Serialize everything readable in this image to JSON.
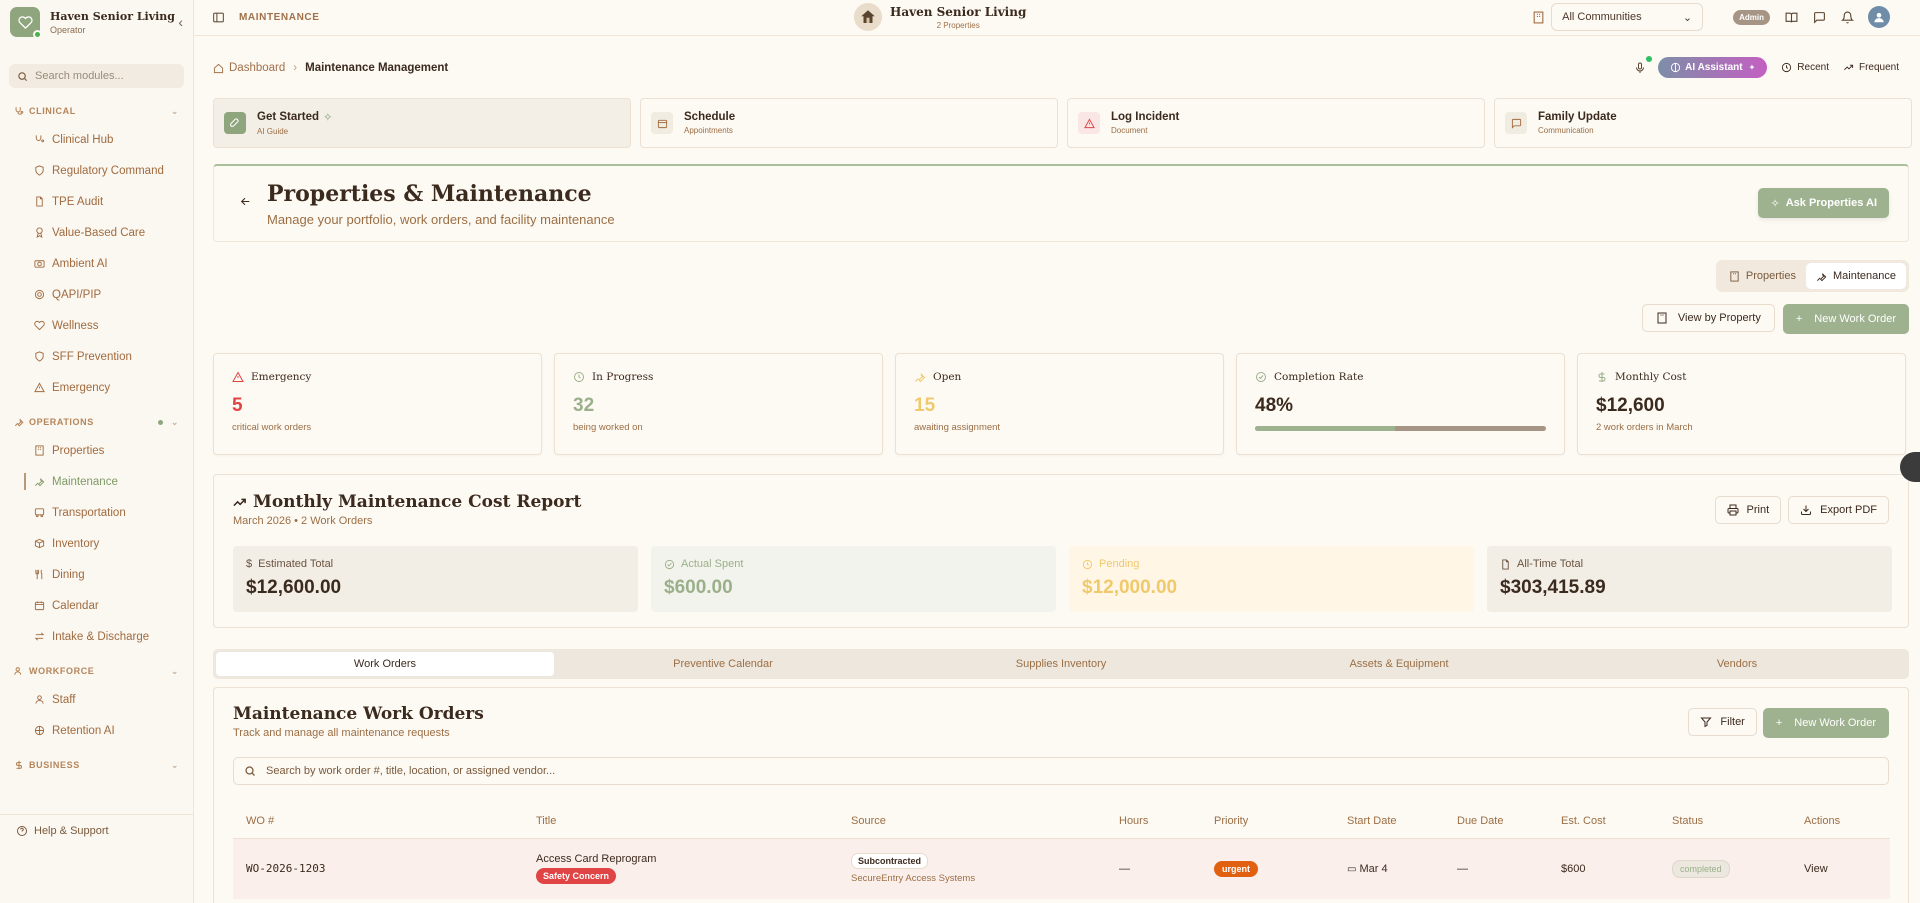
{
  "brand": {
    "name": "Haven Senior Living",
    "role": "Operator"
  },
  "sidebar": {
    "search_placeholder": "Search modules...",
    "sections": {
      "clinical": {
        "label": "CLINICAL",
        "items": [
          "Clinical Hub",
          "Regulatory Command",
          "TPE Audit",
          "Value-Based Care",
          "Ambient AI",
          "QAPI/PIP",
          "Wellness",
          "SFF Prevention",
          "Emergency"
        ]
      },
      "operations": {
        "label": "OPERATIONS",
        "items": [
          "Properties",
          "Maintenance",
          "Transportation",
          "Inventory",
          "Dining",
          "Calendar",
          "Intake & Discharge"
        ]
      },
      "workforce": {
        "label": "WORKFORCE",
        "items": [
          "Staff",
          "Retention AI"
        ]
      },
      "business": {
        "label": "BUSINESS"
      }
    },
    "help": "Help & Support"
  },
  "topbar": {
    "page": "MAINTENANCE",
    "center_title": "Haven Senior Living",
    "center_sub": "2 Properties",
    "community": "All Communities",
    "admin": "Admin"
  },
  "breadcrumb": {
    "home": "Dashboard",
    "current": "Maintenance Management"
  },
  "header_actions": {
    "ai": "AI Assistant",
    "recent": "Recent",
    "frequent": "Frequent"
  },
  "quick_actions": [
    {
      "title": "Get Started",
      "sub": "AI Guide"
    },
    {
      "title": "Schedule",
      "sub": "Appointments"
    },
    {
      "title": "Log Incident",
      "sub": "Document"
    },
    {
      "title": "Family Update",
      "sub": "Communication"
    }
  ],
  "hero": {
    "title": "Properties & Maintenance",
    "subtitle": "Manage your portfolio, work orders, and facility maintenance",
    "ask": "Ask Properties AI"
  },
  "view_toggle": {
    "properties": "Properties",
    "maintenance": "Maintenance"
  },
  "actions": {
    "view_by_property": "View by Property",
    "new_work_order": "New Work Order"
  },
  "stats": [
    {
      "label": "Emergency",
      "value": "5",
      "sub": "critical work orders",
      "color": "#e04444"
    },
    {
      "label": "In Progress",
      "value": "32",
      "sub": "being worked on",
      "color": "#9bb08a"
    },
    {
      "label": "Open",
      "value": "15",
      "sub": "awaiting assignment",
      "color": "#f0c96c"
    },
    {
      "label": "Completion Rate",
      "value": "48%",
      "progress": 48,
      "color": "#3b2a1e"
    },
    {
      "label": "Monthly Cost",
      "value": "$12,600",
      "sub": "2 work orders in March",
      "color": "#3b2a1e"
    }
  ],
  "report": {
    "title": "Monthly Maintenance Cost Report",
    "sub": "March 2026 • 2 Work Orders",
    "print": "Print",
    "export": "Export PDF",
    "cards": [
      {
        "label": "Estimated Total",
        "value": "$12,600.00"
      },
      {
        "label": "Actual Spent",
        "value": "$600.00"
      },
      {
        "label": "Pending",
        "value": "$12,000.00"
      },
      {
        "label": "All-Time Total",
        "value": "$303,415.89"
      }
    ]
  },
  "tabs": [
    "Work Orders",
    "Preventive Calendar",
    "Supplies Inventory",
    "Assets & Equipment",
    "Vendors"
  ],
  "work_orders": {
    "title": "Maintenance Work Orders",
    "sub": "Track and manage all maintenance requests",
    "filter": "Filter",
    "new": "New Work Order",
    "search_placeholder": "Search by work order #, title, location, or assigned vendor...",
    "columns": [
      "WO #",
      "Title",
      "Source",
      "Hours",
      "Priority",
      "Start Date",
      "Due Date",
      "Est. Cost",
      "Status",
      "Actions"
    ],
    "rows": [
      {
        "wo": "WO-2026-1203",
        "title": "Access Card Reprogram",
        "tag": "Safety Concern",
        "source": "Subcontracted",
        "vendor": "SecureEntry Access Systems",
        "hours": "—",
        "priority": "urgent",
        "start": "Mar 4",
        "due": "—",
        "cost": "$600",
        "status": "completed",
        "action": "View"
      }
    ]
  }
}
